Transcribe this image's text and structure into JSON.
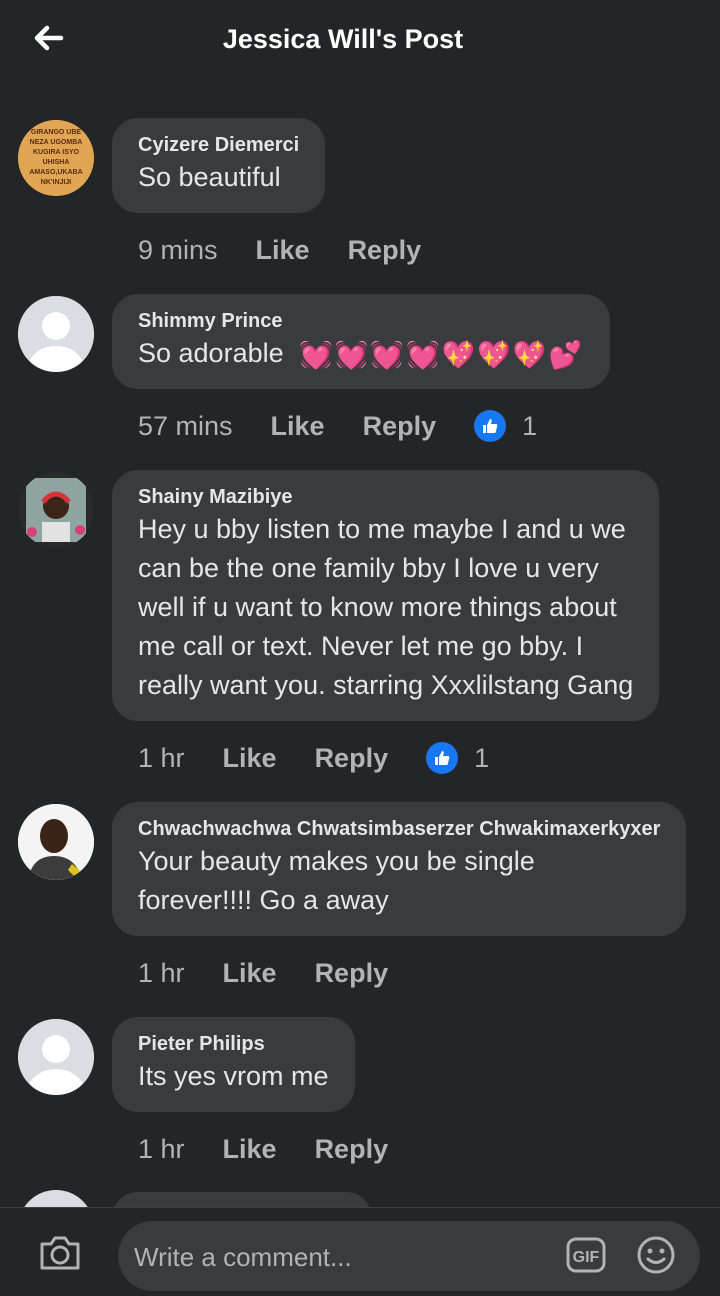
{
  "header": {
    "title": "Jessica Will's Post"
  },
  "avatar_badge_lines": [
    "GIRANGO UBE",
    "NEZA UGOMBA",
    "KUGIRA ISYO",
    "UHISHA",
    "AMASO,UKABA",
    "NK'INJIJI"
  ],
  "comments": [
    {
      "name": "Cyizere Diemerci",
      "lines": [
        "So beautiful"
      ],
      "time": "9 mins",
      "like": "Like",
      "reply": "Reply",
      "reactions": ""
    },
    {
      "name": "Shimmy Prince",
      "lines": [
        "So adorable"
      ],
      "emojis": [
        "💓",
        "💓",
        "💓",
        "💓",
        "💖",
        "💖",
        "💖",
        "💕"
      ],
      "time": "57 mins",
      "like": "Like",
      "reply": "Reply",
      "reactions": "1"
    },
    {
      "name": "Shainy Mazibiye",
      "lines": [
        "Hey u bby listen to me maybe I and u we",
        "can be the one family bby I love u very",
        "well if u want to know more things about",
        "me call or text. Never let me go bby. I",
        "really want you. starring Xxxlilstang Gang"
      ],
      "time": "1 hr",
      "like": "Like",
      "reply": "Reply",
      "reactions": "1"
    },
    {
      "name": "Chwachwachwa Chwatsimbaserzer Chwakimaxerkyxer",
      "lines": [
        "Your beauty makes you be single",
        "forever!!!! Go a away"
      ],
      "time": "1 hr",
      "like": "Like",
      "reply": "Reply",
      "reactions": ""
    },
    {
      "name": "Pieter Philips",
      "lines": [
        "Its yes vrom me"
      ],
      "time": "1 hr",
      "like": "Like",
      "reply": "Reply",
      "reactions": ""
    }
  ],
  "composer": {
    "placeholder": "Write a comment...",
    "gif_label": "GIF"
  },
  "colors": {
    "background": "#242526",
    "bubble": "#3a3b3c",
    "like_blue": "#1877f2",
    "text": "#e4e6eb",
    "meta": "#b0b3b8"
  }
}
